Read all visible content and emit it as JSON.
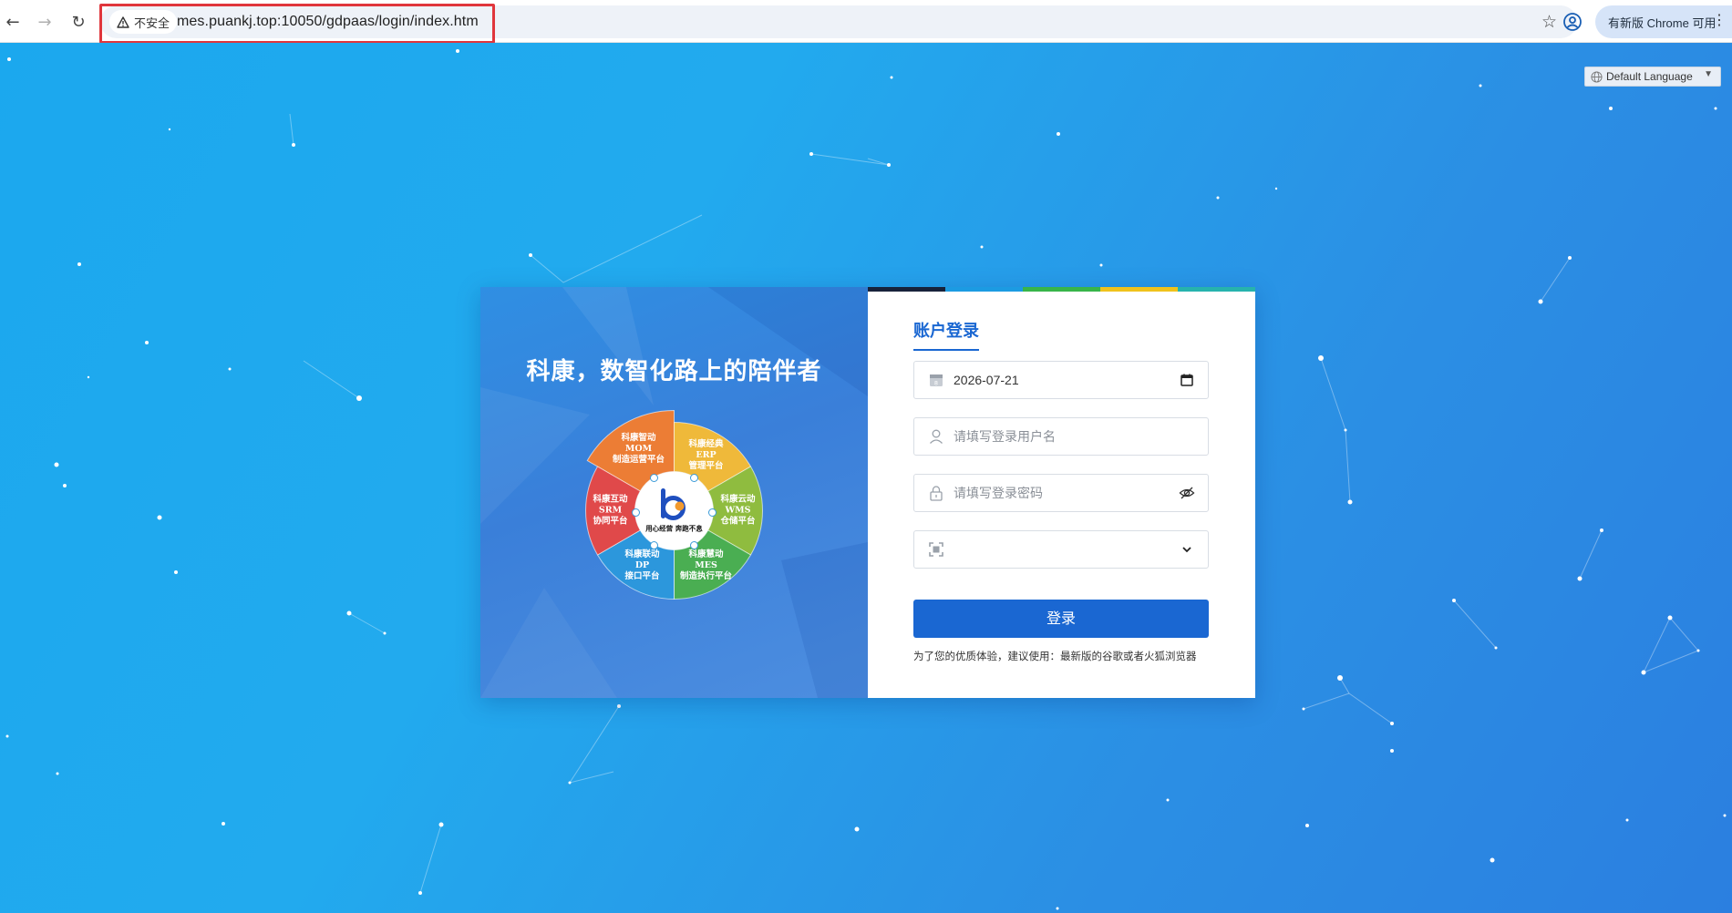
{
  "browser": {
    "security_label": "不安全",
    "url": "mes.puankj.top:10050/gdpaas/login/index.htm",
    "update_label": "有新版 Chrome 可用"
  },
  "language": {
    "selected": "Default Language"
  },
  "promo": {
    "title": "科康，数智化路上的陪伴者",
    "slogan": "用心经营 奔跑不息",
    "segments": [
      {
        "lines": [
          "科康智动",
          "MOM",
          "制造运营平台"
        ],
        "color": "#ec7d35"
      },
      {
        "lines": [
          "科康经典",
          "ERP",
          "管理平台"
        ],
        "color": "#efb93a"
      },
      {
        "lines": [
          "科康云动",
          "WMS",
          "仓储平台"
        ],
        "color": "#8fbc3f"
      },
      {
        "lines": [
          "科康慧动",
          "MES",
          "制造执行平台"
        ],
        "color": "#4aae52"
      },
      {
        "lines": [
          "科康联动",
          "DP",
          "接口平台"
        ],
        "color": "#2c97dc"
      },
      {
        "lines": [
          "科康互动",
          "SRM",
          "协同平台"
        ],
        "color": "#e0494a"
      }
    ]
  },
  "form": {
    "title": "账户登录",
    "date_value": "2026-07-21",
    "username_placeholder": "请填写登录用户名",
    "password_placeholder": "请填写登录密码",
    "org_value": "",
    "login_label": "登录",
    "hint": "为了您的优质体验，建议使用：最新版的谷歌或者火狐浏览器",
    "strip_colors": [
      "#17223a",
      "#1c9be2",
      "#38b54a",
      "#f0c21c",
      "#26b3ad"
    ]
  }
}
